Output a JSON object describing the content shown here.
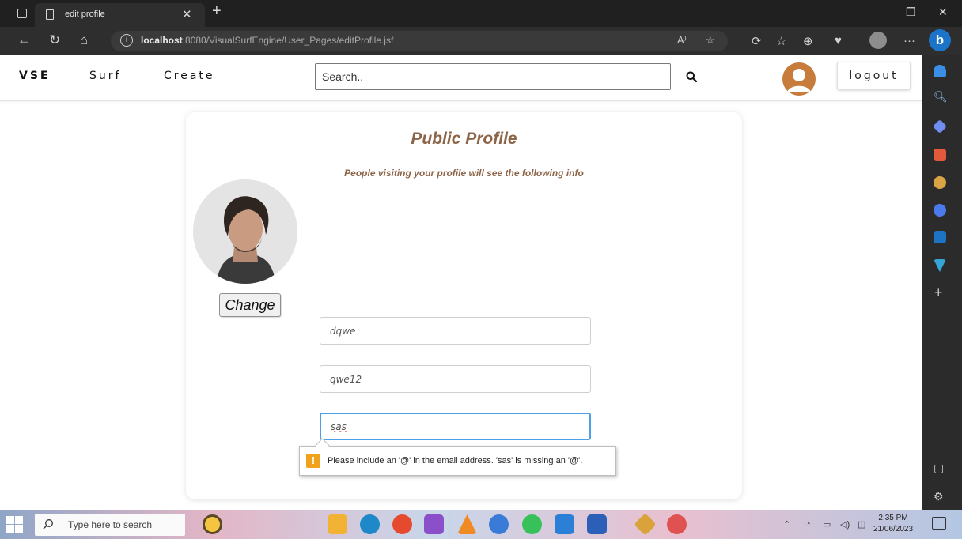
{
  "browser": {
    "tab_title": "edit profile",
    "url_host": "localhost",
    "url_path": ":8080/VisualSurfEngine/User_Pages/editProfile.jsf",
    "read_aloud_label": "A⁾",
    "bing_label": "b"
  },
  "site_nav": {
    "brand": "VSE",
    "links": [
      "Surf",
      "Create"
    ],
    "search_placeholder": "Search..",
    "logout_label": "logout"
  },
  "profile_card": {
    "title": "Public Profile",
    "subtitle": "People visiting your profile will see the following info",
    "change_label": "Change",
    "fields": [
      {
        "value": "dqwe"
      },
      {
        "value": "qwe12"
      },
      {
        "value": "sas",
        "focused": true
      }
    ],
    "validation_message": "Please include an '@' in the email address. 'sas' is missing an '@'."
  },
  "taskbar": {
    "search_placeholder": "Type here to search",
    "time": "2:35 PM",
    "date": "21/06/2023"
  },
  "colors": {
    "accent_brown": "#8c6448",
    "avatar_orange": "#c77c3c",
    "focus_blue": "#4ea1e8",
    "warning_orange": "#f0a21a",
    "bing_blue": "#1b74c7"
  }
}
